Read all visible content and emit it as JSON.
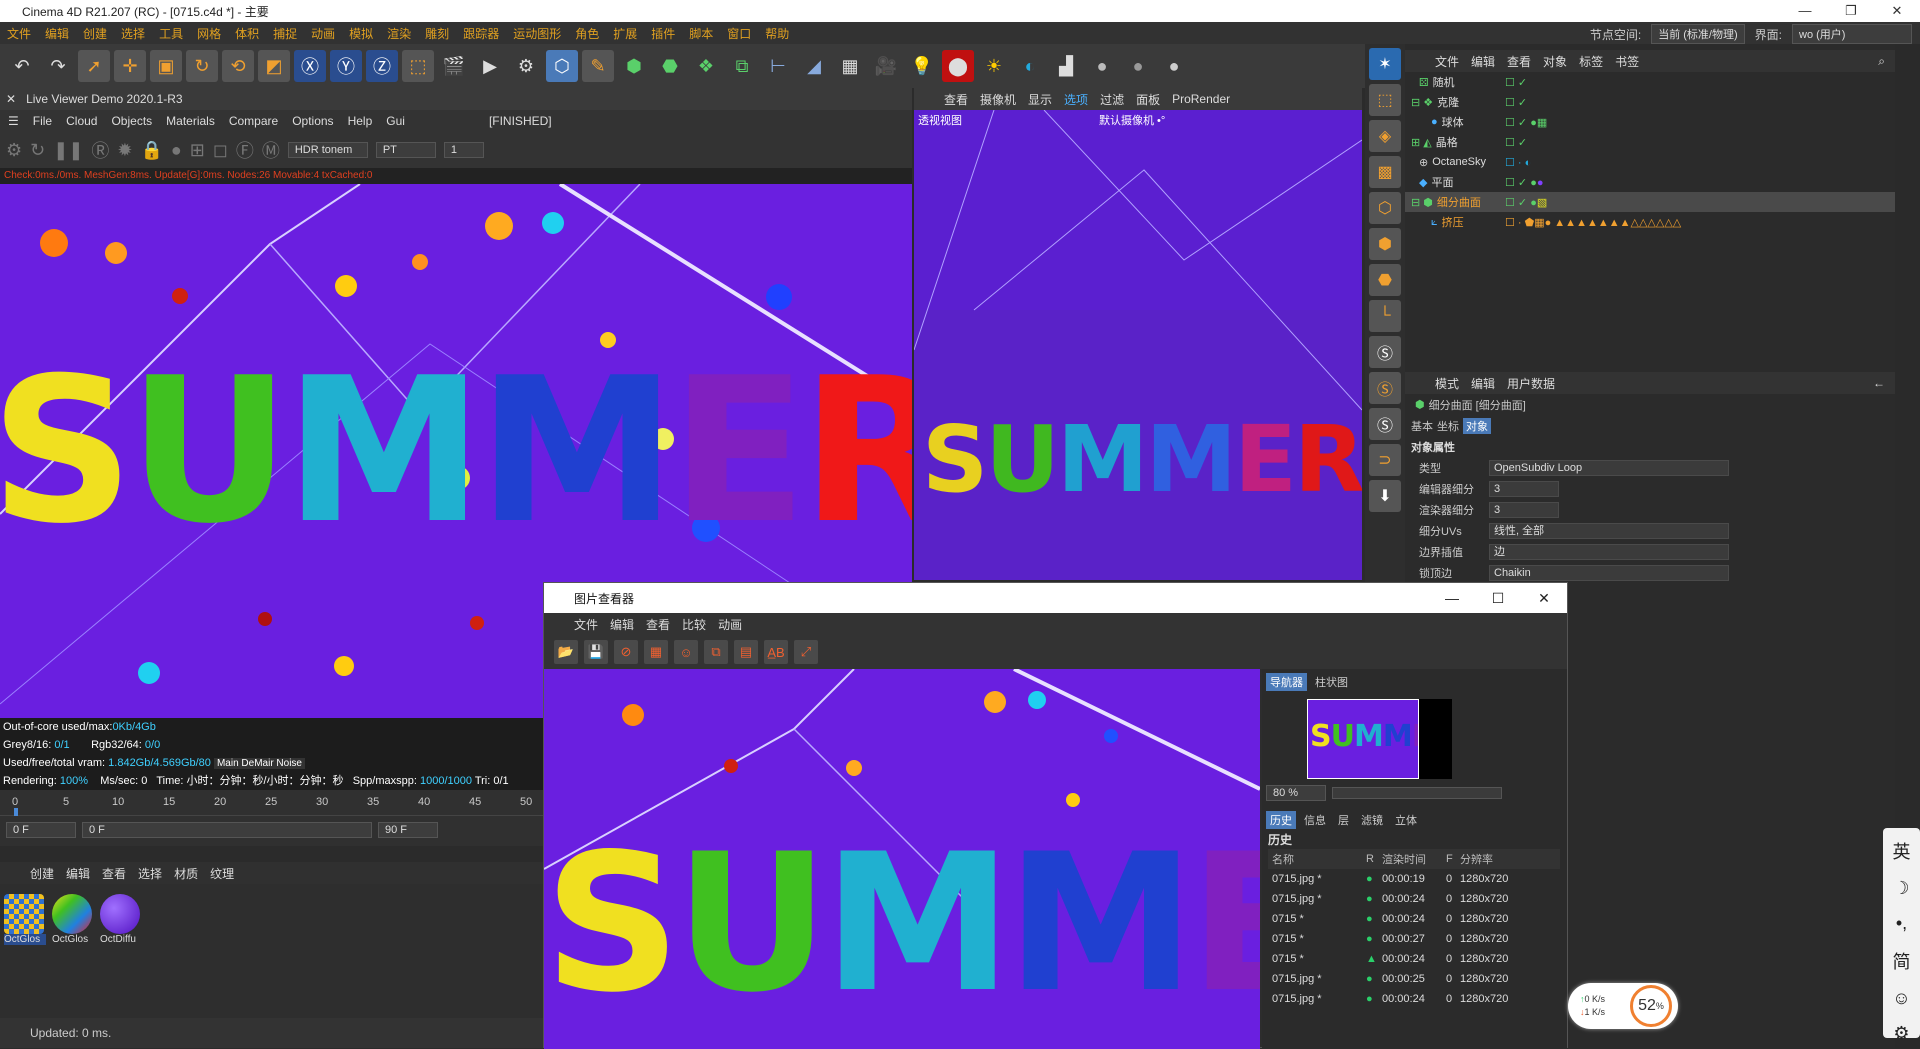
{
  "window": {
    "title": "Cinema 4D R21.207 (RC) - [0715.c4d *] - 主要",
    "min": "—",
    "max": "❐",
    "close": "✕"
  },
  "menubar": {
    "items": [
      "文件",
      "编辑",
      "创建",
      "选择",
      "工具",
      "网格",
      "体积",
      "捕捉",
      "动画",
      "模拟",
      "渲染",
      "雕刻",
      "跟踪器",
      "运动图形",
      "角色",
      "扩展",
      "插件",
      "脚本",
      "窗口",
      "帮助"
    ],
    "node_label": "节点空间:",
    "node_value": "当前 (标准/物理)",
    "layout_label": "界面:",
    "layout_value": "wo (用户)"
  },
  "live_viewer": {
    "title": "Live Viewer Demo 2020.1-R3",
    "menu": [
      "File",
      "Cloud",
      "Objects",
      "Materials",
      "Compare",
      "Options",
      "Help",
      "Gui"
    ],
    "state": "[FINISHED]",
    "tonemap": "HDR tonem",
    "kernel": "PT",
    "value": "1",
    "status": "Check:0ms./0ms. MeshGen:8ms. Update[G]:0ms. Nodes:26 Movable:4 txCached:0",
    "stats": {
      "outofcore_label": "Out-of-core used/max:",
      "outofcore": "0Kb/4Gb",
      "grey_label": "Grey8/16:",
      "grey": "0/1",
      "rgb_label": "Rgb32/64:",
      "rgb": "0/0",
      "vram_label": "Used/free/total vram:",
      "vram": "1.842Gb/4.569Gb/80",
      "noise": "Main DeMair Noise",
      "rendering_label": "Rendering:",
      "rendering": "100%",
      "mssec": "Ms/sec: 0",
      "time": "Time: 小时：分钟：秒/小时：分钟：秒",
      "spp_label": "Spp/maxspp:",
      "spp": "1000/1000",
      "tri": "Tri: 0/1"
    }
  },
  "timeline": {
    "ticks": [
      "0",
      "5",
      "10",
      "15",
      "20",
      "25",
      "30",
      "35",
      "40",
      "45",
      "50"
    ],
    "start": "0 F",
    "current": "0 F",
    "end": "90 F",
    "end2": "90 F"
  },
  "materials": {
    "menu": [
      "创建",
      "编辑",
      "查看",
      "选择",
      "材质",
      "纹理"
    ],
    "items": [
      "OctGlos",
      "OctGlos",
      "OctDiffu"
    ]
  },
  "status_bar": "Updated: 0 ms.",
  "viewport": {
    "menu": [
      "查看",
      "摄像机",
      "显示",
      "选项",
      "过滤",
      "面板",
      "ProRender"
    ],
    "label": "透视视图",
    "camera": "默认摄像机 •°"
  },
  "summer_text": "SUMMER",
  "object_manager": {
    "menu": [
      "文件",
      "编辑",
      "查看",
      "对象",
      "标签",
      "书签"
    ],
    "objects": [
      "随机",
      "克隆",
      "球体",
      "晶格",
      "OctaneSky",
      "平面",
      "细分曲面",
      "挤压"
    ]
  },
  "attributes": {
    "menu": [
      "模式",
      "编辑",
      "用户数据"
    ],
    "object_name": "细分曲面 [细分曲面]",
    "tabs": [
      "基本",
      "坐标",
      "对象"
    ],
    "section": "对象属性",
    "rows": [
      {
        "label": "类型",
        "value": "OpenSubdiv Loop"
      },
      {
        "label": "编辑器细分",
        "value": "3"
      },
      {
        "label": "渲染器细分",
        "value": "3"
      },
      {
        "label": "细分UVs",
        "value": "线性, 全部"
      },
      {
        "label": "边界插值",
        "value": "边"
      },
      {
        "label": "锁顶边",
        "value": "Chaikin"
      }
    ]
  },
  "picture_viewer": {
    "title": "图片查看器",
    "menu": [
      "文件",
      "编辑",
      "查看",
      "比较",
      "动画"
    ],
    "nav_tabs": [
      "导航器",
      "柱状图"
    ],
    "zoom": "80 %",
    "tabs": [
      "历史",
      "信息",
      "层",
      "滤镜",
      "立体"
    ],
    "history_label": "历史",
    "columns": [
      "名称",
      "R",
      "渲染时间",
      "F",
      "分辨率"
    ],
    "rows": [
      {
        "name": "0715.jpg *",
        "time": "00:00:19",
        "f": "0",
        "res": "1280x720"
      },
      {
        "name": "0715.jpg *",
        "time": "00:00:24",
        "f": "0",
        "res": "1280x720"
      },
      {
        "name": "0715 *",
        "time": "00:00:24",
        "f": "0",
        "res": "1280x720"
      },
      {
        "name": "0715 *",
        "time": "00:00:27",
        "f": "0",
        "res": "1280x720"
      },
      {
        "name": "0715 *",
        "time": "00:00:24",
        "f": "0",
        "res": "1280x720"
      },
      {
        "name": "0715.jpg *",
        "time": "00:00:25",
        "f": "0",
        "res": "1280x720"
      },
      {
        "name": "0715.jpg *",
        "time": "00:00:24",
        "f": "0",
        "res": "1280x720"
      }
    ]
  },
  "net_widget": {
    "up": "0 K/s",
    "down": "1 K/s",
    "percent": "52",
    "unit": "%"
  },
  "ime": {
    "items": [
      "英",
      "☽",
      "•,",
      "简",
      "☺",
      "⚙"
    ]
  }
}
